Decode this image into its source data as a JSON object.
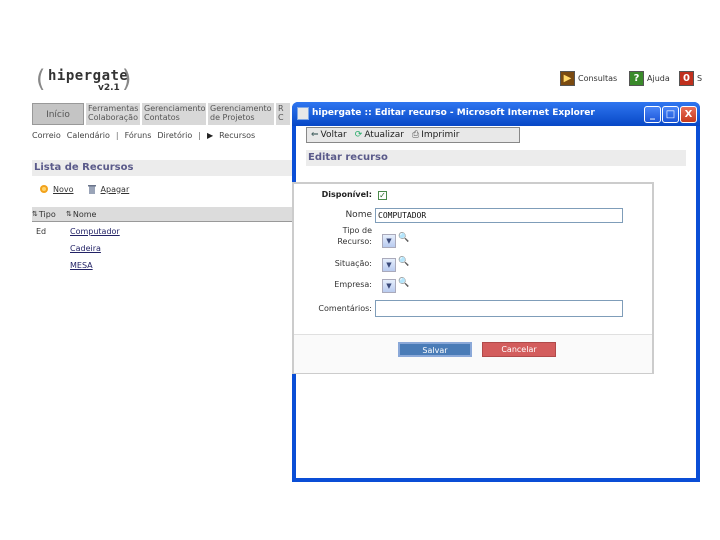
{
  "logo": {
    "brand": "hipergate",
    "version": "v2.1"
  },
  "top_links": [
    {
      "label": "Consultas",
      "icon": "question-list-icon",
      "icon_glyph": "▶",
      "color": "#7a4a10"
    },
    {
      "label": "Ajuda",
      "icon": "help-icon",
      "icon_glyph": "?",
      "color": "#3a8a2a"
    },
    {
      "label": "S",
      "icon": "exit-icon",
      "icon_glyph": "0",
      "color": "#c0301d"
    }
  ],
  "tabs": [
    {
      "label": "Início"
    },
    {
      "label": "Ferramentas\nColaboração"
    },
    {
      "label": "Gerenciamento\nContatos"
    },
    {
      "label": "Gerenciamento\nde Projetos"
    },
    {
      "label": "R\nC"
    }
  ],
  "subnav": {
    "items": [
      "Correio",
      "Calendário",
      "Fóruns",
      "Diretório",
      "Recursos"
    ],
    "separator": "|",
    "active_marker": "▶"
  },
  "list": {
    "title": "Lista de Recursos",
    "new_label": "Novo",
    "delete_label": "Apagar",
    "headers": {
      "type": "Tipo",
      "name": "Nome"
    },
    "rows": [
      {
        "type": "Ed",
        "name": "Computador"
      },
      {
        "type": "",
        "name": "Cadeira"
      },
      {
        "type": "",
        "name": "MESA"
      }
    ]
  },
  "ie": {
    "title": "hipergate :: Editar recurso - Microsoft Internet Explorer",
    "buttons": {
      "minimize": "_",
      "maximize": "□",
      "close": "X"
    },
    "toolbar": {
      "back": "Voltar",
      "refresh": "Atualizar",
      "print": "Imprimir"
    },
    "page_title": "Editar recurso",
    "form": {
      "available_label": "Disponível:",
      "available_checked": "✓",
      "name_label": "Nome",
      "name_value": "COMPUTADOR",
      "type_label_1": "Tipo de",
      "type_label_2": "Recurso:",
      "status_label": "Situação:",
      "company_label": "Empresa:",
      "comments_label": "Comentários:",
      "comments_value": "",
      "dropdown_arrow": "▼",
      "search_glyph": "🔍"
    },
    "save_label": "Salvar",
    "cancel_label": "Cancelar"
  },
  "colors": {
    "title_bar": "#0747c6",
    "section_title": "#5a5a8a",
    "save_button": "#4a7cb7",
    "cancel_button": "#d35d5d"
  }
}
